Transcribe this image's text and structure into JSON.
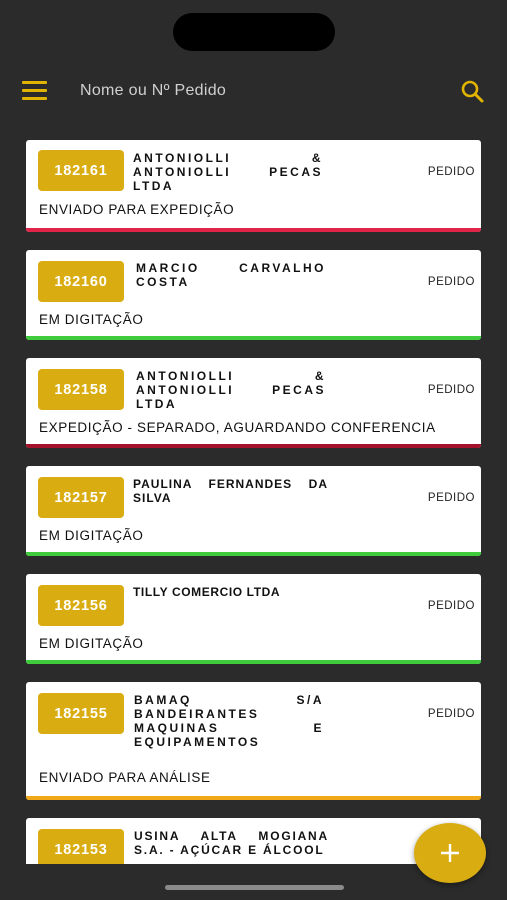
{
  "header": {
    "search_placeholder": "Nome ou Nº Pedido"
  },
  "colors": {
    "accent": "#d9ad12",
    "status_red": "#e0244a",
    "status_green": "#3fcb3b",
    "status_orange": "#f0a818",
    "background": "#2b2b2b"
  },
  "orders": [
    {
      "number": "182161",
      "client": "ANTONIOLLI & ANTONIOLLI PECAS LTDA",
      "type": "PEDIDO",
      "status": "ENVIADO PARA EXPEDIÇÃO",
      "status_color": "red"
    },
    {
      "number": "182160",
      "client": "MARCIO CARVALHO COSTA",
      "type": "PEDIDO",
      "status": "EM DIGITAÇÃO",
      "status_color": "green"
    },
    {
      "number": "182158",
      "client": "ANTONIOLLI & ANTONIOLLI PECAS LTDA",
      "type": "PEDIDO",
      "status": "EXPEDIÇÃO - SEPARADO, AGUARDANDO CONFERENCIA",
      "status_color": "dark-red"
    },
    {
      "number": "182157",
      "client": "PAULINA FERNANDES DA SILVA",
      "type": "PEDIDO",
      "status": "EM DIGITAÇÃO",
      "status_color": "green"
    },
    {
      "number": "182156",
      "client": "TILLY COMERCIO LTDA",
      "type": "PEDIDO",
      "status": "EM DIGITAÇÃO",
      "status_color": "green"
    },
    {
      "number": "182155",
      "client": "BAMAQ S/A BANDEIRANTES MAQUINAS E EQUIPAMENTOS",
      "type": "PEDIDO",
      "status": "ENVIADO PARA ANÁLISE",
      "status_color": "orange"
    },
    {
      "number": "182153",
      "client": "USINA ALTA MOGIANA S.A. - AÇÚCAR E ÁLCOOL",
      "type": "",
      "status": "",
      "status_color": ""
    }
  ]
}
